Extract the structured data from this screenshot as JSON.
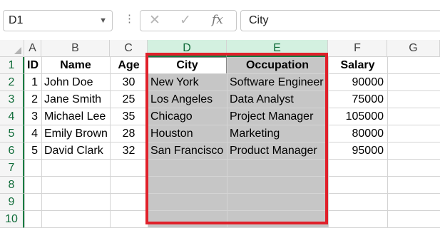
{
  "formula_bar": {
    "name_box": "D1",
    "cancel_icon": "✕",
    "enter_icon": "✓",
    "fx_label": "fx",
    "formula_value": "City"
  },
  "columns": [
    "A",
    "B",
    "C",
    "D",
    "E",
    "F",
    "G"
  ],
  "selected_columns": [
    "D",
    "E"
  ],
  "rows": [
    "1",
    "2",
    "3",
    "4",
    "5",
    "6",
    "7",
    "8",
    "9",
    "10"
  ],
  "table": {
    "headers": [
      "ID",
      "Name",
      "Age",
      "City",
      "Occupation",
      "Salary"
    ],
    "records": [
      [
        "1",
        "John Doe",
        "30",
        "New York",
        "Software Engineer",
        "90000"
      ],
      [
        "2",
        "Jane Smith",
        "25",
        "Los Angeles",
        "Data Analyst",
        "75000"
      ],
      [
        "3",
        "Michael Lee",
        "35",
        "Chicago",
        "Project Manager",
        "105000"
      ],
      [
        "4",
        "Emily Brown",
        "28",
        "Houston",
        "Marketing",
        "80000"
      ],
      [
        "5",
        "David Clark",
        "32",
        "San Francisco",
        "Product Manager",
        "95000"
      ]
    ]
  },
  "highlight_color": "#e0202a",
  "selection_color": "#c6c6c6",
  "accent_color": "#107c41"
}
